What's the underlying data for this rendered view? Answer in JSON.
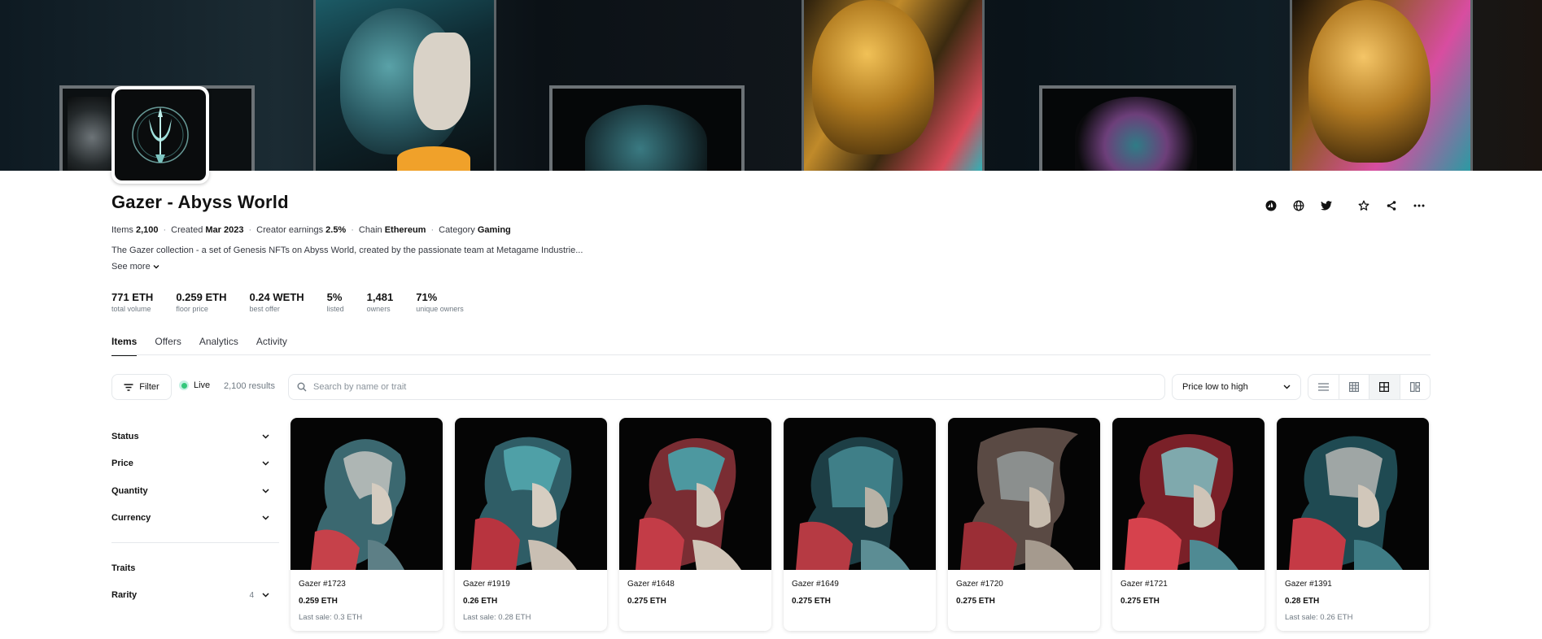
{
  "collection": {
    "name": "Gazer - Abyss World",
    "meta": [
      {
        "label": "Items",
        "value": "2,100"
      },
      {
        "label": "Created",
        "value": "Mar 2023"
      },
      {
        "label": "Creator earnings",
        "value": "2.5%"
      },
      {
        "label": "Chain",
        "value": "Ethereum"
      },
      {
        "label": "Category",
        "value": "Gaming"
      }
    ],
    "description": "The Gazer collection - a set of Genesis NFTs on Abyss World, created by the passionate team at Metagame Industrie...",
    "see_more": "See more"
  },
  "header_icons": [
    "opensea-icon",
    "globe-icon",
    "twitter-icon",
    "star-icon",
    "share-icon",
    "more-icon"
  ],
  "stats": [
    {
      "value": "771 ETH",
      "label": "total volume"
    },
    {
      "value": "0.259 ETH",
      "label": "floor price"
    },
    {
      "value": "0.24 WETH",
      "label": "best offer"
    },
    {
      "value": "5%",
      "label": "listed"
    },
    {
      "value": "1,481",
      "label": "owners"
    },
    {
      "value": "71%",
      "label": "unique owners"
    }
  ],
  "tabs": [
    {
      "label": "Items",
      "active": true
    },
    {
      "label": "Offers",
      "active": false
    },
    {
      "label": "Analytics",
      "active": false
    },
    {
      "label": "Activity",
      "active": false
    }
  ],
  "toolbar": {
    "filter_label": "Filter",
    "live_label": "Live",
    "results": "2,100 results",
    "search_placeholder": "Search by name or trait",
    "sort_value": "Price low to high",
    "view_modes": [
      "list-view-icon",
      "grid-small-icon",
      "grid-large-icon",
      "grid-mosaic-icon"
    ],
    "active_view": 2
  },
  "sidebar": {
    "filters": [
      "Status",
      "Price",
      "Quantity",
      "Currency"
    ],
    "traits_label": "Traits",
    "rarity": {
      "label": "Rarity",
      "count": "4"
    }
  },
  "items": [
    {
      "name": "Gazer #1723",
      "price": "0.259 ETH",
      "last_sale": "Last sale: 0.3 ETH"
    },
    {
      "name": "Gazer #1919",
      "price": "0.26 ETH",
      "last_sale": "Last sale: 0.28 ETH"
    },
    {
      "name": "Gazer #1648",
      "price": "0.275 ETH",
      "last_sale": ""
    },
    {
      "name": "Gazer #1649",
      "price": "0.275 ETH",
      "last_sale": ""
    },
    {
      "name": "Gazer #1720",
      "price": "0.275 ETH",
      "last_sale": ""
    },
    {
      "name": "Gazer #1721",
      "price": "0.275 ETH",
      "last_sale": ""
    },
    {
      "name": "Gazer #1391",
      "price": "0.28 ETH",
      "last_sale": "Last sale: 0.26 ETH"
    }
  ],
  "colors": {
    "text": "#121212",
    "muted": "#707a83",
    "border": "#e5e8eb",
    "live": "#34c77b"
  }
}
